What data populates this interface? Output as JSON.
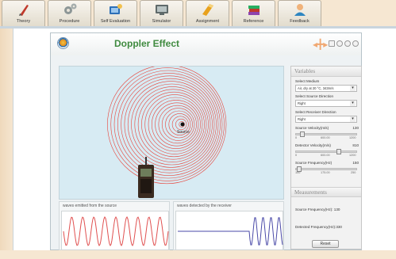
{
  "tabs": [
    {
      "label": "Theory",
      "icon": "theory-icon",
      "color": "#c0392b"
    },
    {
      "label": "Procedure",
      "icon": "gears-icon",
      "color": "#7f8c8d"
    },
    {
      "label": "Self Evaluation",
      "icon": "self-evaluation-icon",
      "color": "#2c6fb7"
    },
    {
      "label": "Simulator",
      "icon": "simulator-icon",
      "color": "#5f6a6a"
    },
    {
      "label": "Assignment",
      "icon": "assignment-icon",
      "color": "#e8a11c"
    },
    {
      "label": "Reference",
      "icon": "books-icon",
      "color": "#8e44ad"
    },
    {
      "label": "Feedback",
      "icon": "feedback-icon",
      "color": "#2e86c1"
    }
  ],
  "panel": {
    "title": "Doppler Effect",
    "title_color": "#3f8a3f"
  },
  "simulation": {
    "source_label": "Source",
    "wave_color": "#e8453c"
  },
  "waves": {
    "emitted_caption": "waves emitted from the source",
    "detected_caption": "waves detected by the receiver",
    "emitted_color": "#e05050",
    "detected_color": "#4a4aa8"
  },
  "variables": {
    "heading": "Variables",
    "medium_label": "Select Medium",
    "medium_value": "Air, dry at 20 °C, 343m/s",
    "source_direction_label": "Select Source Direction",
    "source_direction_value": "Right",
    "receiver_direction_label": "Select Receiver Direction",
    "receiver_direction_value": "Right",
    "source_velocity_label": "Source Velocity(m/s)",
    "source_velocity_value": "130",
    "source_velocity_ticks": [
      "0",
      "600.00",
      "1200"
    ],
    "detector_velocity_label": "Detector Velocity(m/s)",
    "detector_velocity_value": "810",
    "detector_velocity_ticks": [
      "0",
      "600.00",
      "1200"
    ],
    "source_frequency_label": "Source Frequency(Hz)",
    "source_frequency_value": "150",
    "source_frequency_ticks": [
      "100",
      "175.00",
      "250"
    ]
  },
  "measurements": {
    "heading": "Measurements",
    "source_freq_label": "Source Frequency(Hz): 130",
    "detected_freq_label": "Detected Frequency(Hz):330",
    "reset_label": "Reset"
  }
}
